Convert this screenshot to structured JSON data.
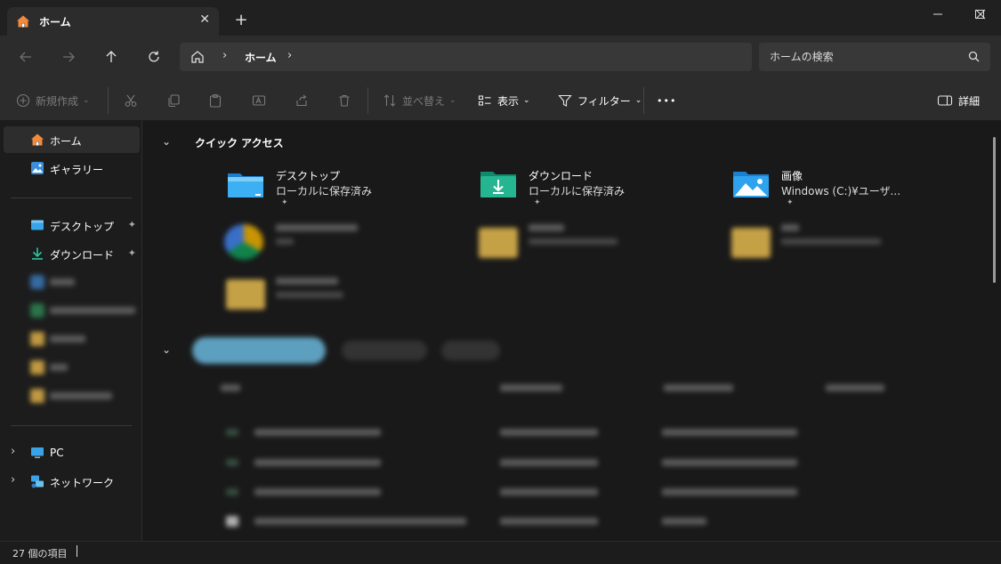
{
  "window": {
    "tab_title": "ホーム",
    "close_tab": "✕",
    "new_tab": "+"
  },
  "address": {
    "breadcrumb": "ホーム",
    "separator": "›"
  },
  "search": {
    "placeholder": "ホームの検索"
  },
  "toolbar": {
    "new_label": "新規作成",
    "sort_label": "並べ替え",
    "view_label": "表示",
    "filter_label": "フィルター",
    "more_label": "•••",
    "details_label": "詳細"
  },
  "sidebar": {
    "home": "ホーム",
    "gallery": "ギャラリー",
    "desktop": "デスクトップ",
    "downloads": "ダウンロード",
    "pc": "PC",
    "network": "ネットワーク",
    "pin_glyph": "📌"
  },
  "quick_access": {
    "title": "クイック アクセス",
    "items": [
      {
        "name": "デスクトップ",
        "sub": "ローカルに保存済み"
      },
      {
        "name": "ダウンロード",
        "sub": "ローカルに保存済み"
      },
      {
        "name": "画像",
        "sub": "Windows (C:)¥ユーザ..."
      }
    ]
  },
  "status": {
    "item_count": "27 個の項目"
  },
  "colors": {
    "background": "#191919",
    "chrome": "#2c2c2c",
    "accent_folder_blue": "#2f9ee6",
    "accent_download_green": "#1fa88a",
    "folder_yellow": "#f4c753"
  }
}
